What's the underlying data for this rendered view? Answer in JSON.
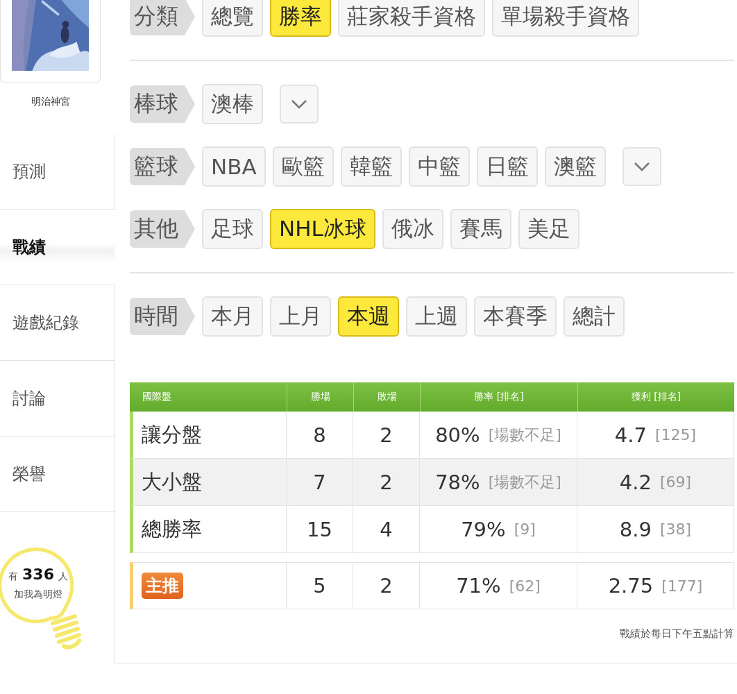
{
  "sidebar": {
    "profile": {
      "name": "明治神宮"
    },
    "menu": [
      {
        "label": "預測",
        "selected": false
      },
      {
        "label": "戰績",
        "selected": true
      },
      {
        "label": "遊戲紀錄",
        "selected": false
      },
      {
        "label": "討論",
        "selected": false
      },
      {
        "label": "榮譽",
        "selected": false
      }
    ],
    "fans": {
      "prefix": "有",
      "count": "336",
      "suffix": "人",
      "caption": "加我為明燈"
    }
  },
  "filters": [
    {
      "label": "分類",
      "has_dropdown": false,
      "divider_after": true,
      "options": [
        {
          "label": "總覽",
          "selected": false
        },
        {
          "label": "勝率",
          "selected": true
        },
        {
          "label": "莊家殺手資格",
          "selected": false
        },
        {
          "label": "單場殺手資格",
          "selected": false
        }
      ]
    },
    {
      "label": "棒球",
      "has_dropdown": true,
      "divider_after": false,
      "options": [
        {
          "label": "澳棒",
          "selected": false
        }
      ]
    },
    {
      "label": "籃球",
      "has_dropdown": true,
      "divider_after": false,
      "options": [
        {
          "label": "NBA",
          "selected": false
        },
        {
          "label": "歐籃",
          "selected": false
        },
        {
          "label": "韓籃",
          "selected": false
        },
        {
          "label": "中籃",
          "selected": false
        },
        {
          "label": "日籃",
          "selected": false
        },
        {
          "label": "澳籃",
          "selected": false
        }
      ]
    },
    {
      "label": "其他",
      "has_dropdown": false,
      "divider_after": true,
      "options": [
        {
          "label": "足球",
          "selected": false
        },
        {
          "label": "NHL冰球",
          "selected": true
        },
        {
          "label": "俄冰",
          "selected": false
        },
        {
          "label": "賽馬",
          "selected": false
        },
        {
          "label": "美足",
          "selected": false
        }
      ]
    },
    {
      "label": "時間",
      "has_dropdown": false,
      "divider_after": false,
      "options": [
        {
          "label": "本月",
          "selected": false
        },
        {
          "label": "上月",
          "selected": false
        },
        {
          "label": "本週",
          "selected": true
        },
        {
          "label": "上週",
          "selected": false
        },
        {
          "label": "本賽季",
          "selected": false
        },
        {
          "label": "總計",
          "selected": false
        }
      ]
    }
  ],
  "table": {
    "columns": [
      "國際盤",
      "勝場",
      "敗場",
      "勝率 [排名]",
      "獲利 [排名]"
    ],
    "rows": [
      {
        "label": "讓分盤",
        "wins": "8",
        "losses": "2",
        "rate": "80%",
        "rate_rank": "[場數不足]",
        "profit": "4.7",
        "profit_rank": "[125]"
      },
      {
        "label": "大小盤",
        "wins": "7",
        "losses": "2",
        "rate": "78%",
        "rate_rank": "[場數不足]",
        "profit": "4.2",
        "profit_rank": "[69]"
      },
      {
        "label": "總勝率",
        "wins": "15",
        "losses": "4",
        "rate": "79%",
        "rate_rank": "[9]",
        "profit": "8.9",
        "profit_rank": "[38]"
      }
    ],
    "featured": {
      "badge": "主推",
      "wins": "5",
      "losses": "2",
      "rate": "71%",
      "rate_rank": "[62]",
      "profit": "2.75",
      "profit_rank": "[177]"
    }
  },
  "footer_note": "戰績於每日下午五點計算"
}
